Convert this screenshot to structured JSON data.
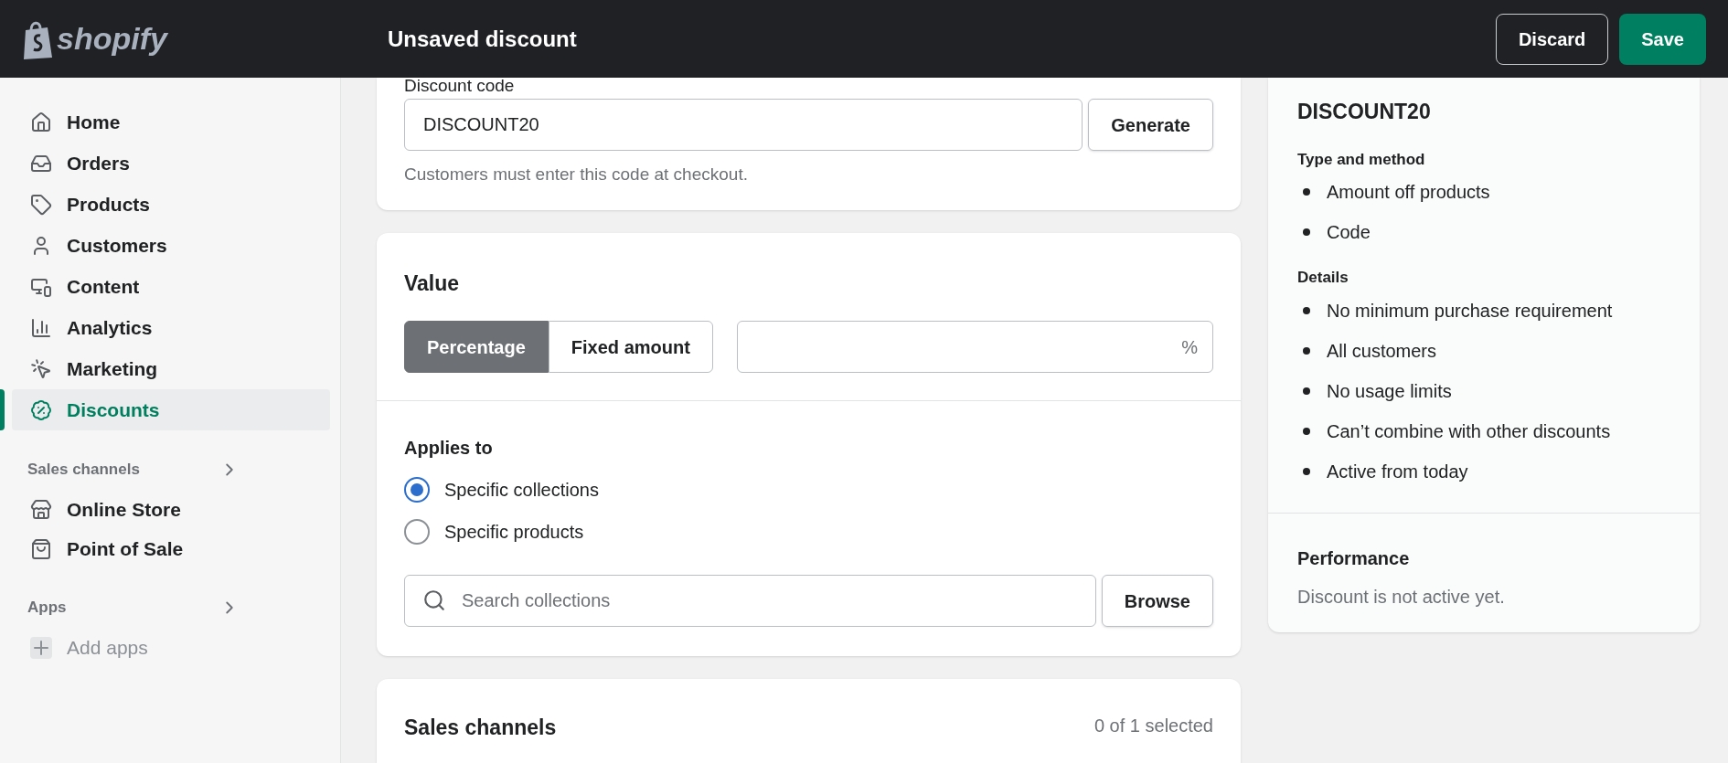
{
  "topbar": {
    "logo": "shopify",
    "title": "Unsaved discount",
    "buttons": [
      {
        "label": "Discard",
        "kind": "secondary"
      },
      {
        "label": "Save",
        "kind": "primary"
      }
    ]
  },
  "sidebar": {
    "nav": [
      {
        "label": "Home",
        "selected": false
      },
      {
        "label": "Orders",
        "selected": false
      },
      {
        "label": "Products",
        "selected": false
      },
      {
        "label": "Customers",
        "selected": false
      },
      {
        "label": "Content",
        "selected": false
      },
      {
        "label": "Analytics",
        "selected": false
      },
      {
        "label": "Marketing",
        "selected": false
      },
      {
        "label": "Discounts",
        "selected": true
      }
    ],
    "sections": [
      {
        "title": "Sales channels",
        "items": [
          {
            "label": "Online Store",
            "disabled": false
          },
          {
            "label": "Point of Sale",
            "disabled": false
          }
        ]
      },
      {
        "title": "Apps",
        "items": [
          {
            "label": "Add apps",
            "disabled": true
          }
        ]
      }
    ]
  },
  "code_card": {
    "label": "Discount code",
    "value": "DISCOUNT20",
    "button": "Generate",
    "help": "Customers must enter this code at checkout."
  },
  "value_card": {
    "title": "Value",
    "options": [
      {
        "label": "Percentage",
        "selected": true
      },
      {
        "label": "Fixed amount",
        "selected": false
      }
    ],
    "suffix": "%",
    "applies_to": {
      "title": "Applies to",
      "options": [
        {
          "label": "Specific collections",
          "selected": true
        },
        {
          "label": "Specific products",
          "selected": false
        }
      ],
      "search_placeholder": "Search collections",
      "button": "Browse"
    }
  },
  "sales_channels": {
    "title": "Sales channels",
    "count": "0 of 1 selected"
  },
  "summary": {
    "title": "DISCOUNT20",
    "sections": [
      {
        "heading": "Type and method",
        "items": [
          "Amount off products",
          "Code"
        ]
      },
      {
        "heading": "Details",
        "items": [
          "No minimum purchase requirement",
          "All customers",
          "No usage limits",
          "Can’t combine with other discounts",
          "Active from today"
        ]
      }
    ],
    "performance": {
      "title": "Performance",
      "text": "Discount is not active yet."
    }
  }
}
